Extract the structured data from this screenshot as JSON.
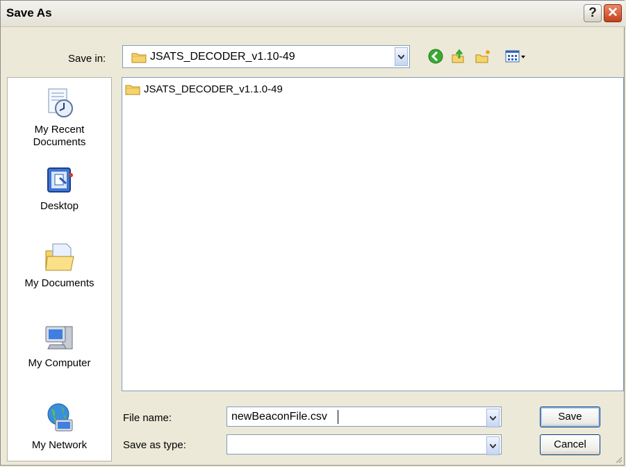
{
  "window": {
    "title": "Save As"
  },
  "title_buttons": {
    "help": "?",
    "close": "✕"
  },
  "save_in": {
    "label": "Save in:",
    "value": "JSATS_DECODER_v1.10-49"
  },
  "toolbar_icons": [
    "back-icon",
    "up-folder-icon",
    "new-folder-icon",
    "views-menu-icon"
  ],
  "places": [
    {
      "id": "recent",
      "label_line1": "My Recent",
      "label_line2": "Documents",
      "icon": "recent-documents-icon"
    },
    {
      "id": "desktop",
      "label_line1": "Desktop",
      "label_line2": "",
      "icon": "desktop-icon"
    },
    {
      "id": "documents",
      "label_line1": "My Documents",
      "label_line2": "",
      "icon": "my-documents-icon"
    },
    {
      "id": "computer",
      "label_line1": "My Computer",
      "label_line2": "",
      "icon": "my-computer-icon"
    },
    {
      "id": "network",
      "label_line1": "My Network",
      "label_line2": "",
      "icon": "my-network-icon"
    }
  ],
  "files": [
    {
      "name": "JSATS_DECODER_v1.1.0-49",
      "icon": "folder-icon"
    }
  ],
  "file_name": {
    "label": "File name:",
    "value": "newBeaconFile.csv"
  },
  "save_as_type": {
    "label": "Save as type:",
    "value": ""
  },
  "buttons": {
    "save": "Save",
    "cancel": "Cancel"
  },
  "colors": {
    "title_gradient_top": "#f3f2ee",
    "close_red": "#c2401b",
    "dialog_bg": "#ece9d8",
    "field_border": "#7f9db9"
  }
}
